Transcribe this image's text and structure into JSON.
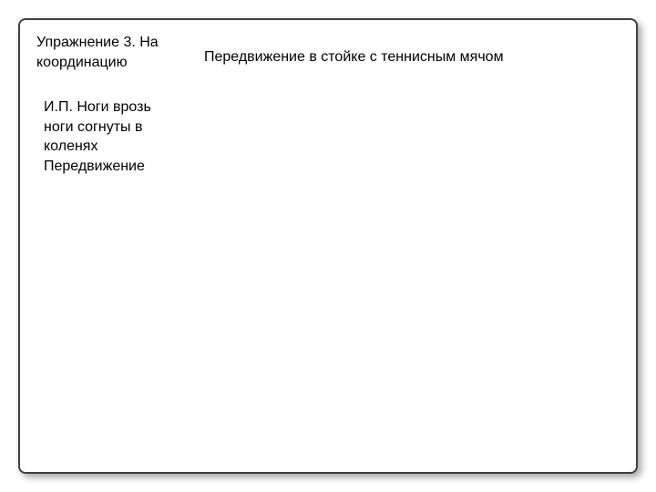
{
  "title": "Упражнение 3. На координацию",
  "subtitle": "Передвижение в стойке с теннисным мячом",
  "description": "И.П. Ноги врозь ноги согнуты в коленях Передвижение"
}
